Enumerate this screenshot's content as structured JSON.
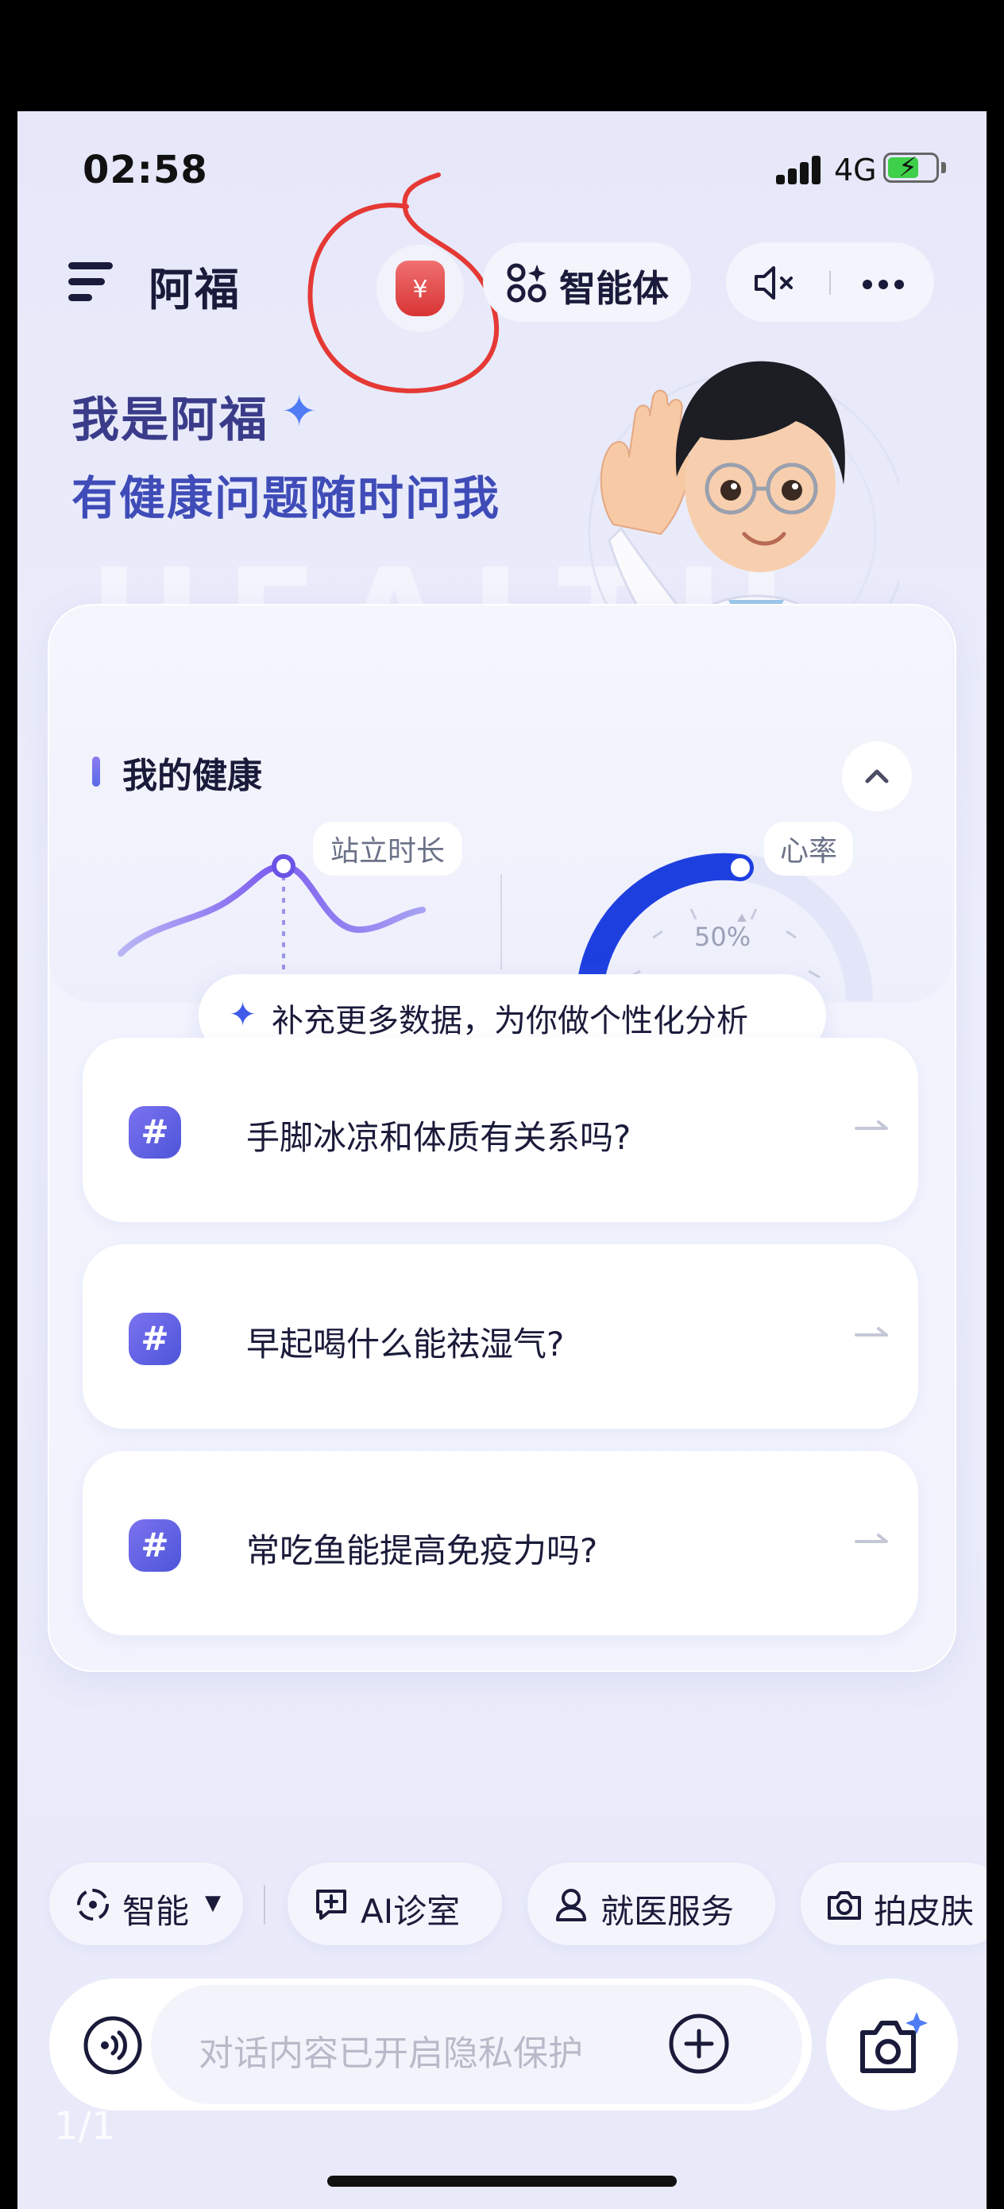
{
  "status_bar": {
    "time": "02:58",
    "network": "4G"
  },
  "header": {
    "app_name": "阿福",
    "agent_button": "智能体"
  },
  "greeting": {
    "line1": "我是阿福",
    "line2": "有健康问题随时问我"
  },
  "health_card": {
    "title": "我的健康",
    "stand_tag": "站立时长",
    "heart_tag": "心率",
    "gauge_value": "50%",
    "supplement_prompt": "补充更多数据，为你做个性化分析"
  },
  "questions": [
    {
      "text": "手脚冰凉和体质有关系吗?"
    },
    {
      "text": "早起喝什么能祛湿气?"
    },
    {
      "text": "常吃鱼能提高免疫力吗?"
    }
  ],
  "chips": [
    {
      "label": "智能",
      "icon": "smart-mode-icon"
    },
    {
      "label": "AI诊室",
      "icon": "chat-plus-icon"
    },
    {
      "label": "就医服务",
      "icon": "person-icon"
    },
    {
      "label": "拍皮肤",
      "icon": "camera-icon"
    }
  ],
  "input": {
    "placeholder": "对话内容已开启隐私保护"
  },
  "page_indicator": "1/1",
  "colors": {
    "accent": "#4d55d8",
    "highlight_circle": "#e53935",
    "heart_gauge": "#1e3fe0"
  }
}
